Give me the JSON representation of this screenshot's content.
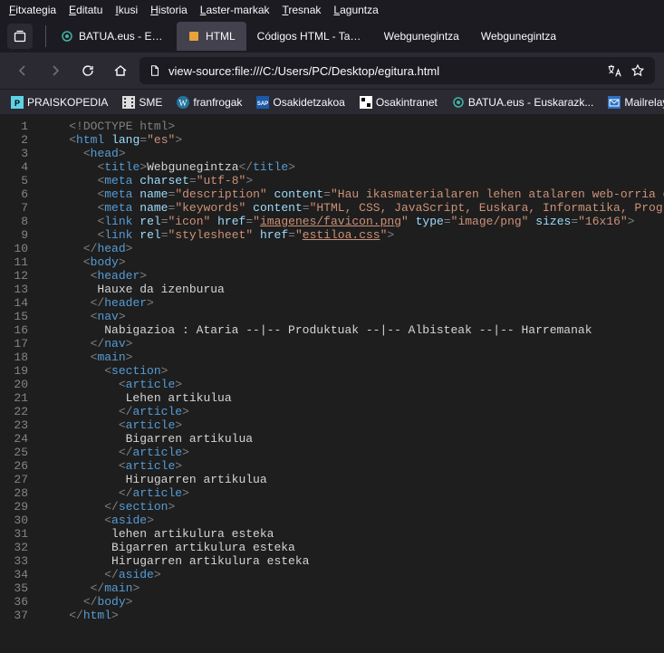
{
  "menubar": [
    "Fitxategia",
    "Editatu",
    "Ikusi",
    "Historia",
    "Laster-markak",
    "Tresnak",
    "Laguntza"
  ],
  "tabs": [
    {
      "label": "BATUA.eus - Euska",
      "active": false,
      "icon": "batua"
    },
    {
      "label": "HTML",
      "active": true,
      "icon": "html"
    },
    {
      "label": "Códigos HTML - Tabla",
      "active": false,
      "icon": null
    },
    {
      "label": "Webgunegintza",
      "active": false,
      "icon": null
    },
    {
      "label": "Webgunegintza",
      "active": false,
      "icon": null
    }
  ],
  "url": "view-source:file:///C:/Users/PC/Desktop/egitura.html",
  "bookmarks": [
    {
      "label": "PRAISKOPEDIA",
      "icon": "cyan"
    },
    {
      "label": "SME",
      "icon": "film"
    },
    {
      "label": "franfrogak",
      "icon": "wp"
    },
    {
      "label": "Osakidetzakoa",
      "icon": "sap"
    },
    {
      "label": "Osakintranet",
      "icon": "osak"
    },
    {
      "label": "BATUA.eus - Euskarazk...",
      "icon": "batua"
    },
    {
      "label": "Mailrelay",
      "icon": "mail"
    }
  ],
  "source_lines": [
    [
      {
        "t": "doctype",
        "v": "<!DOCTYPE html>"
      }
    ],
    [
      {
        "t": "tagbr",
        "v": "<"
      },
      {
        "t": "tagname",
        "v": "html"
      },
      {
        "t": "text",
        "v": " "
      },
      {
        "t": "attrname",
        "v": "lang"
      },
      {
        "t": "tagbr",
        "v": "="
      },
      {
        "t": "attrval",
        "v": "\"es\""
      },
      {
        "t": "tagbr",
        "v": ">"
      }
    ],
    [
      {
        "t": "text",
        "v": "  "
      },
      {
        "t": "tagbr",
        "v": "<"
      },
      {
        "t": "tagname",
        "v": "head"
      },
      {
        "t": "tagbr",
        "v": ">"
      }
    ],
    [
      {
        "t": "text",
        "v": "    "
      },
      {
        "t": "tagbr",
        "v": "<"
      },
      {
        "t": "tagname",
        "v": "title"
      },
      {
        "t": "tagbr",
        "v": ">"
      },
      {
        "t": "text",
        "v": "Webgunegintza"
      },
      {
        "t": "tagbr",
        "v": "</"
      },
      {
        "t": "tagname",
        "v": "title"
      },
      {
        "t": "tagbr",
        "v": ">"
      }
    ],
    [
      {
        "t": "text",
        "v": "    "
      },
      {
        "t": "tagbr",
        "v": "<"
      },
      {
        "t": "tagname",
        "v": "meta"
      },
      {
        "t": "text",
        "v": " "
      },
      {
        "t": "attrname",
        "v": "charset"
      },
      {
        "t": "tagbr",
        "v": "="
      },
      {
        "t": "attrval",
        "v": "\"utf-8\""
      },
      {
        "t": "tagbr",
        "v": ">"
      }
    ],
    [
      {
        "t": "text",
        "v": "    "
      },
      {
        "t": "tagbr",
        "v": "<"
      },
      {
        "t": "tagname",
        "v": "meta"
      },
      {
        "t": "text",
        "v": " "
      },
      {
        "t": "attrname",
        "v": "name"
      },
      {
        "t": "tagbr",
        "v": "="
      },
      {
        "t": "attrval",
        "v": "\"description\""
      },
      {
        "t": "text",
        "v": " "
      },
      {
        "t": "attrname",
        "v": "content"
      },
      {
        "t": "tagbr",
        "v": "="
      },
      {
        "t": "attrval",
        "v": "\"Hau ikasmaterialaren lehen atalaren web-orria da.\""
      },
      {
        "t": "tagbr",
        "v": ">"
      }
    ],
    [
      {
        "t": "text",
        "v": "    "
      },
      {
        "t": "tagbr",
        "v": "<"
      },
      {
        "t": "tagname",
        "v": "meta"
      },
      {
        "t": "text",
        "v": " "
      },
      {
        "t": "attrname",
        "v": "name"
      },
      {
        "t": "tagbr",
        "v": "="
      },
      {
        "t": "attrval",
        "v": "\"keywords\""
      },
      {
        "t": "text",
        "v": " "
      },
      {
        "t": "attrname",
        "v": "content"
      },
      {
        "t": "tagbr",
        "v": "="
      },
      {
        "t": "attrval",
        "v": "\"HTML, CSS, JavaScript, Euskara, Informatika, Programazioa\""
      },
      {
        "t": "tagbr",
        "v": ">"
      }
    ],
    [
      {
        "t": "text",
        "v": "    "
      },
      {
        "t": "tagbr",
        "v": "<"
      },
      {
        "t": "tagname",
        "v": "link"
      },
      {
        "t": "text",
        "v": " "
      },
      {
        "t": "attrname",
        "v": "rel"
      },
      {
        "t": "tagbr",
        "v": "="
      },
      {
        "t": "attrval",
        "v": "\"icon\""
      },
      {
        "t": "text",
        "v": " "
      },
      {
        "t": "attrname",
        "v": "href"
      },
      {
        "t": "tagbr",
        "v": "="
      },
      {
        "t": "attrval",
        "v": "\""
      },
      {
        "t": "linkval",
        "v": "imagenes/favicon.png"
      },
      {
        "t": "attrval",
        "v": "\""
      },
      {
        "t": "text",
        "v": " "
      },
      {
        "t": "attrname",
        "v": "type"
      },
      {
        "t": "tagbr",
        "v": "="
      },
      {
        "t": "attrval",
        "v": "\"image/png\""
      },
      {
        "t": "text",
        "v": " "
      },
      {
        "t": "attrname",
        "v": "sizes"
      },
      {
        "t": "tagbr",
        "v": "="
      },
      {
        "t": "attrval",
        "v": "\"16x16\""
      },
      {
        "t": "tagbr",
        "v": ">"
      }
    ],
    [
      {
        "t": "text",
        "v": "    "
      },
      {
        "t": "tagbr",
        "v": "<"
      },
      {
        "t": "tagname",
        "v": "link"
      },
      {
        "t": "text",
        "v": " "
      },
      {
        "t": "attrname",
        "v": "rel"
      },
      {
        "t": "tagbr",
        "v": "="
      },
      {
        "t": "attrval",
        "v": "\"stylesheet\""
      },
      {
        "t": "text",
        "v": " "
      },
      {
        "t": "attrname",
        "v": "href"
      },
      {
        "t": "tagbr",
        "v": "="
      },
      {
        "t": "attrval",
        "v": "\""
      },
      {
        "t": "linkval",
        "v": "estiloa.css"
      },
      {
        "t": "attrval",
        "v": "\""
      },
      {
        "t": "tagbr",
        "v": ">"
      }
    ],
    [
      {
        "t": "text",
        "v": "  "
      },
      {
        "t": "tagbr",
        "v": "</"
      },
      {
        "t": "tagname",
        "v": "head"
      },
      {
        "t": "tagbr",
        "v": ">"
      }
    ],
    [
      {
        "t": "text",
        "v": "  "
      },
      {
        "t": "tagbr",
        "v": "<"
      },
      {
        "t": "tagname",
        "v": "body"
      },
      {
        "t": "tagbr",
        "v": ">"
      }
    ],
    [
      {
        "t": "text",
        "v": "   "
      },
      {
        "t": "tagbr",
        "v": "<"
      },
      {
        "t": "tagname",
        "v": "header"
      },
      {
        "t": "tagbr",
        "v": ">"
      }
    ],
    [
      {
        "t": "text",
        "v": "    Hauxe da izenburua"
      }
    ],
    [
      {
        "t": "text",
        "v": "   "
      },
      {
        "t": "tagbr",
        "v": "</"
      },
      {
        "t": "tagname",
        "v": "header"
      },
      {
        "t": "tagbr",
        "v": ">"
      }
    ],
    [
      {
        "t": "text",
        "v": "   "
      },
      {
        "t": "tagbr",
        "v": "<"
      },
      {
        "t": "tagname",
        "v": "nav"
      },
      {
        "t": "tagbr",
        "v": ">"
      }
    ],
    [
      {
        "t": "text",
        "v": "     Nabigazioa : Ataria --|-- Produktuak --|-- Albisteak --|-- Harremanak"
      }
    ],
    [
      {
        "t": "text",
        "v": "   "
      },
      {
        "t": "tagbr",
        "v": "</"
      },
      {
        "t": "tagname",
        "v": "nav"
      },
      {
        "t": "tagbr",
        "v": ">"
      }
    ],
    [
      {
        "t": "text",
        "v": "   "
      },
      {
        "t": "tagbr",
        "v": "<"
      },
      {
        "t": "tagname",
        "v": "main"
      },
      {
        "t": "tagbr",
        "v": ">"
      }
    ],
    [
      {
        "t": "text",
        "v": "     "
      },
      {
        "t": "tagbr",
        "v": "<"
      },
      {
        "t": "tagname",
        "v": "section"
      },
      {
        "t": "tagbr",
        "v": ">"
      }
    ],
    [
      {
        "t": "text",
        "v": "       "
      },
      {
        "t": "tagbr",
        "v": "<"
      },
      {
        "t": "tagname",
        "v": "article"
      },
      {
        "t": "tagbr",
        "v": ">"
      }
    ],
    [
      {
        "t": "text",
        "v": "        Lehen artikulua"
      }
    ],
    [
      {
        "t": "text",
        "v": "       "
      },
      {
        "t": "tagbr",
        "v": "</"
      },
      {
        "t": "tagname",
        "v": "article"
      },
      {
        "t": "tagbr",
        "v": ">"
      }
    ],
    [
      {
        "t": "text",
        "v": "       "
      },
      {
        "t": "tagbr",
        "v": "<"
      },
      {
        "t": "tagname",
        "v": "article"
      },
      {
        "t": "tagbr",
        "v": ">"
      }
    ],
    [
      {
        "t": "text",
        "v": "        Bigarren artikulua"
      }
    ],
    [
      {
        "t": "text",
        "v": "       "
      },
      {
        "t": "tagbr",
        "v": "</"
      },
      {
        "t": "tagname",
        "v": "article"
      },
      {
        "t": "tagbr",
        "v": ">"
      }
    ],
    [
      {
        "t": "text",
        "v": "       "
      },
      {
        "t": "tagbr",
        "v": "<"
      },
      {
        "t": "tagname",
        "v": "article"
      },
      {
        "t": "tagbr",
        "v": ">"
      }
    ],
    [
      {
        "t": "text",
        "v": "        Hirugarren artikulua"
      }
    ],
    [
      {
        "t": "text",
        "v": "       "
      },
      {
        "t": "tagbr",
        "v": "</"
      },
      {
        "t": "tagname",
        "v": "article"
      },
      {
        "t": "tagbr",
        "v": ">"
      }
    ],
    [
      {
        "t": "text",
        "v": "     "
      },
      {
        "t": "tagbr",
        "v": "</"
      },
      {
        "t": "tagname",
        "v": "section"
      },
      {
        "t": "tagbr",
        "v": ">"
      }
    ],
    [
      {
        "t": "text",
        "v": "     "
      },
      {
        "t": "tagbr",
        "v": "<"
      },
      {
        "t": "tagname",
        "v": "aside"
      },
      {
        "t": "tagbr",
        "v": ">"
      }
    ],
    [
      {
        "t": "text",
        "v": "      lehen artikulura esteka"
      }
    ],
    [
      {
        "t": "text",
        "v": "      Bigarren artikulura esteka"
      }
    ],
    [
      {
        "t": "text",
        "v": "      Hirugarren artikulura esteka"
      }
    ],
    [
      {
        "t": "text",
        "v": "     "
      },
      {
        "t": "tagbr",
        "v": "</"
      },
      {
        "t": "tagname",
        "v": "aside"
      },
      {
        "t": "tagbr",
        "v": ">"
      }
    ],
    [
      {
        "t": "text",
        "v": "   "
      },
      {
        "t": "tagbr",
        "v": "</"
      },
      {
        "t": "tagname",
        "v": "main"
      },
      {
        "t": "tagbr",
        "v": ">"
      }
    ],
    [
      {
        "t": "text",
        "v": "  "
      },
      {
        "t": "tagbr",
        "v": "</"
      },
      {
        "t": "tagname",
        "v": "body"
      },
      {
        "t": "tagbr",
        "v": ">"
      }
    ],
    [
      {
        "t": "tagbr",
        "v": "</"
      },
      {
        "t": "tagname",
        "v": "html"
      },
      {
        "t": "tagbr",
        "v": ">"
      }
    ]
  ],
  "base_indent": "    "
}
